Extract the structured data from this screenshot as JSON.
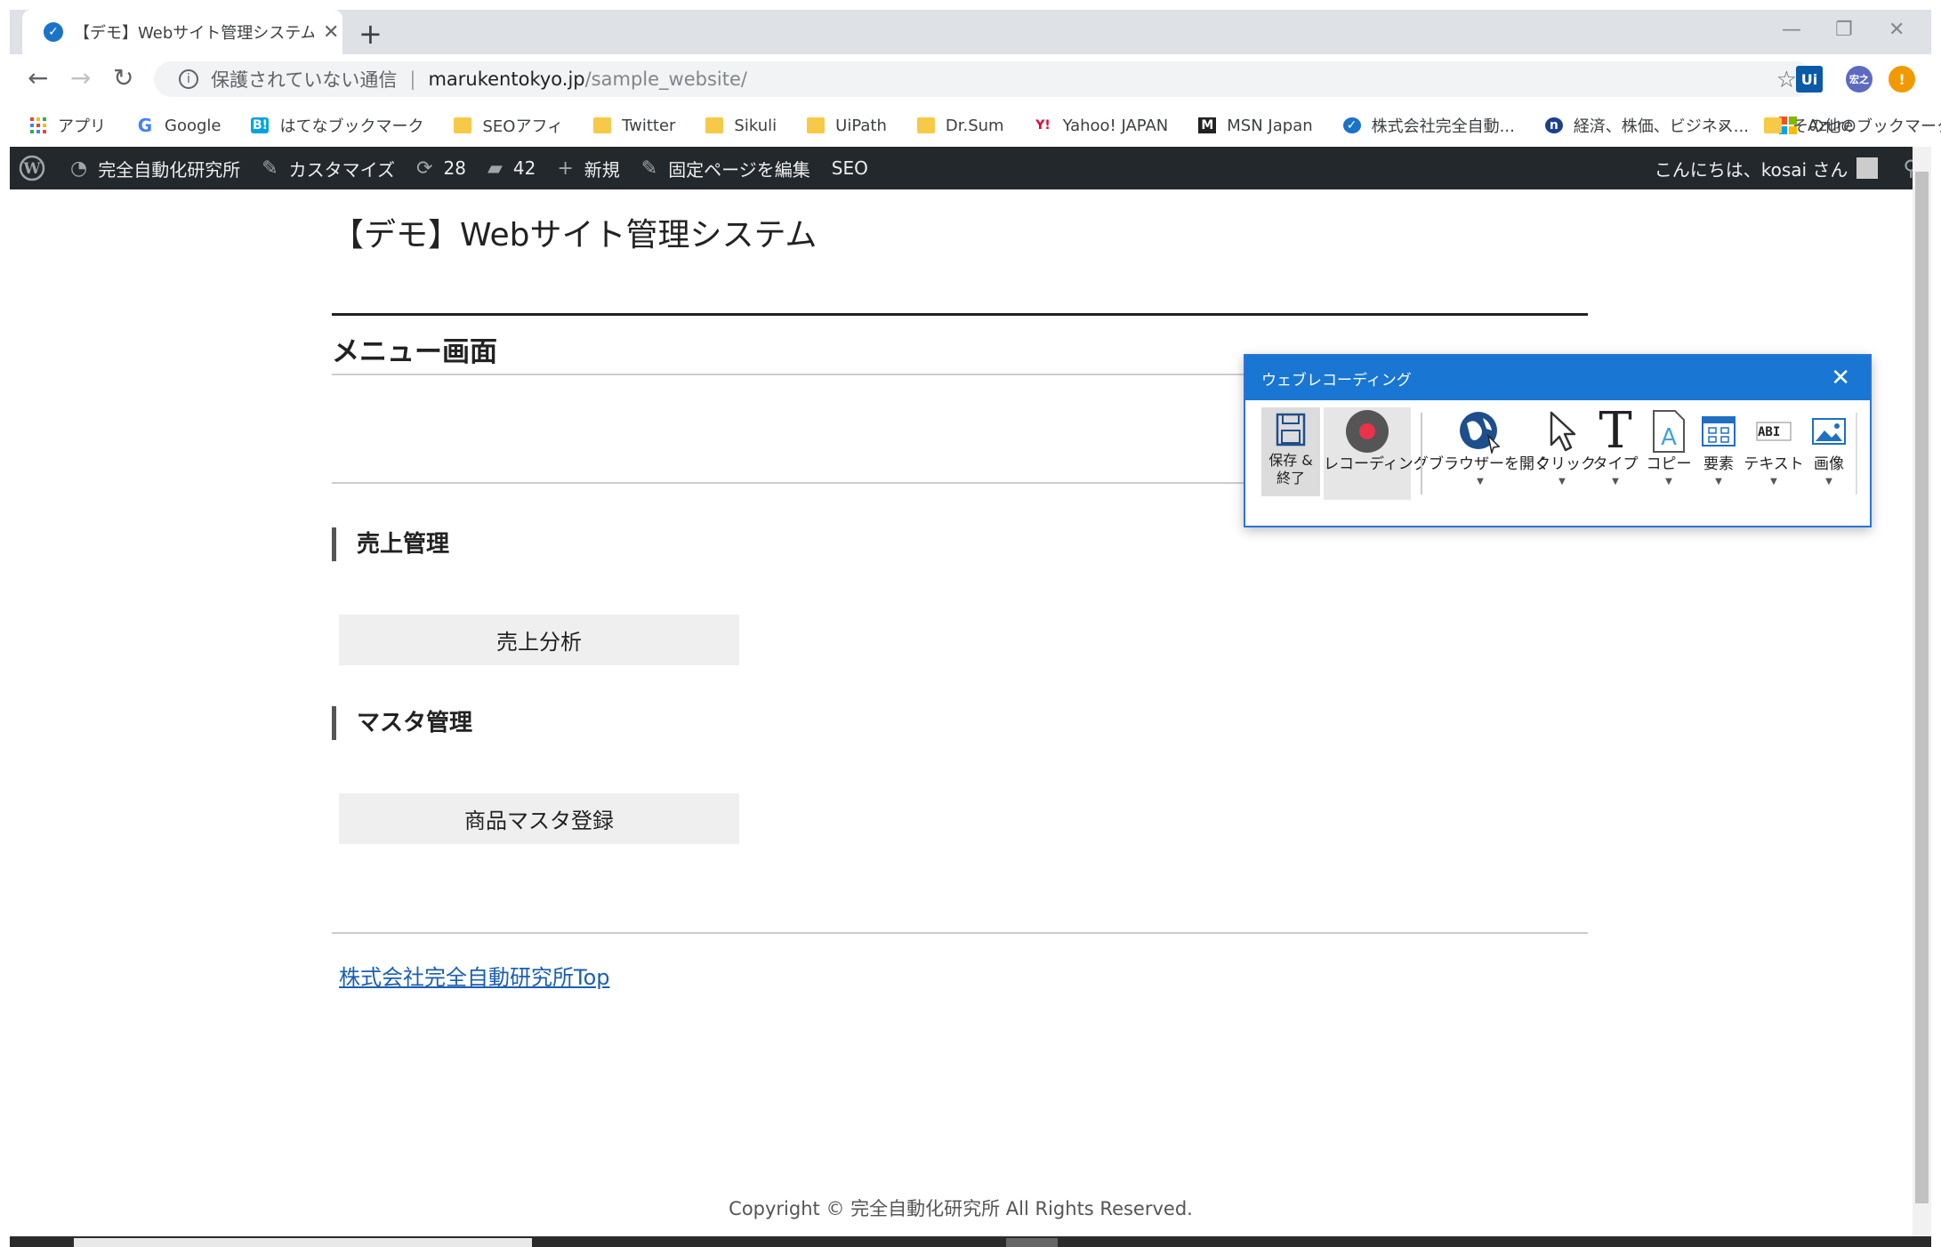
{
  "browser": {
    "tab_title": "【デモ】Webサイト管理システム – 完全",
    "tab_close": "✕",
    "new_tab": "+",
    "window_controls": [
      "—",
      "❐",
      "✕"
    ],
    "nav": {
      "back": "←",
      "forward": "→",
      "reload": "↻"
    },
    "url_security": "保護されていない通信",
    "url_separator": "|",
    "url_host": "marukentokyo.jp",
    "url_path": "/sample_website/",
    "bookmark_star": "☆",
    "extensions": [
      "Ui",
      "宏之",
      "!"
    ]
  },
  "bookmarks": [
    {
      "label": "アプリ",
      "icon": "apps-grid-icon"
    },
    {
      "label": "Google",
      "icon": "google-icon"
    },
    {
      "label": "はてなブックマーク",
      "icon": "hatena-icon"
    },
    {
      "label": "SEOアフィ",
      "icon": "folder-icon"
    },
    {
      "label": "Twitter",
      "icon": "folder-icon"
    },
    {
      "label": "Sikuli",
      "icon": "folder-icon"
    },
    {
      "label": "UiPath",
      "icon": "folder-icon"
    },
    {
      "label": "Dr.Sum",
      "icon": "folder-icon"
    },
    {
      "label": "Yahoo! JAPAN",
      "icon": "yahoo-icon"
    },
    {
      "label": "MSN Japan",
      "icon": "msn-icon"
    },
    {
      "label": "株式会社完全自動...",
      "icon": "site-icon"
    },
    {
      "label": "経済、株価、ビジネス...",
      "icon": "nikkei-icon"
    },
    {
      "label": "Azure",
      "icon": "microsoft-icon"
    }
  ],
  "bookmarks_overflow": "»",
  "bookmarks_other": "その他のブックマーク",
  "adminbar": {
    "site_name": "完全自動化研究所",
    "customize": "カスタマイズ",
    "updates": "28",
    "comments": "42",
    "new": "新規",
    "edit_page": "固定ページを編集",
    "seo": "SEO",
    "greeting": "こんにちは、kosai さん"
  },
  "page": {
    "site_title": "【デモ】Webサイト管理システム",
    "page_title": "メニュー画面",
    "sections": [
      {
        "heading": "売上管理",
        "button": "売上分析"
      },
      {
        "heading": "マスタ管理",
        "button": "商品マスタ登録"
      }
    ],
    "company_link": "株式会社完全自動研究所Top",
    "copyright": "Copyright © 完全自動化研究所 All Rights Reserved."
  },
  "recorder": {
    "title": "ウェブレコーディング",
    "close": "✕",
    "tools": [
      {
        "label": "保存 &\n終了",
        "icon": "save-icon"
      },
      {
        "label": "レコーディング",
        "icon": "record-icon"
      },
      {
        "label": "ブラウザーを開く",
        "icon": "open-browser-icon",
        "dropdown": true
      },
      {
        "label": "クリック",
        "icon": "click-icon",
        "dropdown": true
      },
      {
        "label": "タイプ",
        "icon": "type-icon",
        "dropdown": true
      },
      {
        "label": "コピー",
        "icon": "copy-icon",
        "dropdown": true
      },
      {
        "label": "要素",
        "icon": "element-icon",
        "dropdown": true
      },
      {
        "label": "テキスト",
        "icon": "text-icon",
        "dropdown": true
      },
      {
        "label": "画像",
        "icon": "image-icon",
        "dropdown": true
      }
    ],
    "colors": {
      "titlebar": "#1976d2",
      "record": "#e8334a"
    }
  }
}
